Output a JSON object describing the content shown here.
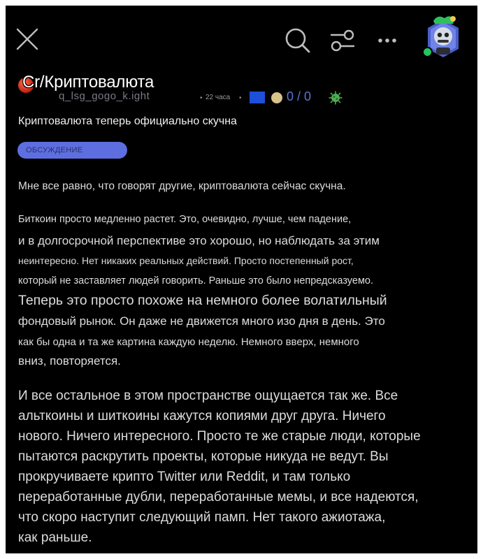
{
  "topbar": {
    "close_icon": "close-icon",
    "search_icon": "search-icon",
    "filter_icon": "filter-icon",
    "more_icon": "more-dots-icon",
    "avatar_icon": "user-avatar"
  },
  "post": {
    "community": "Cr/Криптовалюта",
    "username": "q_lsg_gogo_k.ight",
    "time": "22 часа",
    "score": "0 / 0",
    "title": "Криптовалюта теперь официально скучна",
    "flair": "ОБСУЖДЕНИЕ",
    "lines": [
      "Мне все равно, что говорят другие, криптовалюта сейчас скучна.",
      "Биткоин просто медленно растет. Это, очевидно, лучше, чем падение,",
      "и в долгосрочной перспективе это хорошо, но наблюдать за этим",
      "неинтересно. Нет никаких реальных действий. Просто постепенный рост,",
      "который не заставляет людей говорить. Раньше это было непредсказуемо.",
      "Теперь это просто похоже на немного более волатильный",
      "фондовый рынок. Он даже не движется много изо дня в день. Это",
      "как бы одна и та же картина каждую неделю. Немного вверх, немного",
      "вниз, повторяется.",
      "И все остальное в этом пространстве ощущается так же. Все",
      "альткоины и шиткоины кажутся копиями друг друга. Ничего",
      "нового. Ничего интересного. Просто те же старые люди, которые",
      "пытаются раскрутить проекты, которые никуда не ведут. Вы",
      "прокручиваете крипто Twitter или Reddit, и там только",
      "переработанные дубли, переработанные мемы, и все надеются,",
      "что скоро наступит следующий памп. Нет такого ажиотажа,",
      "как раньше."
    ]
  },
  "colors": {
    "background": "#000000",
    "flair_bg": "#5d6fe0",
    "score": "#5b76d6",
    "flair_square": "#1d4fd8",
    "online": "#22c55e"
  }
}
